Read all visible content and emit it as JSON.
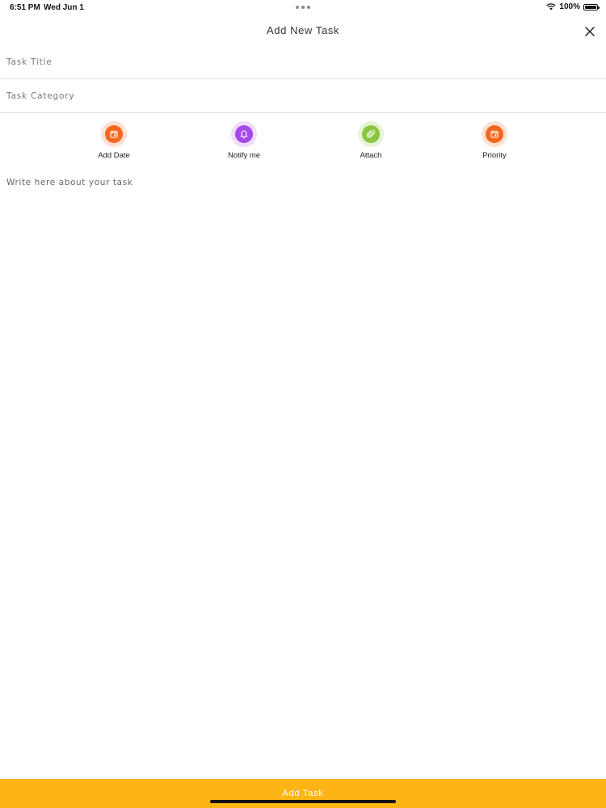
{
  "status_bar": {
    "time": "6:51 PM",
    "date": "Wed Jun 1",
    "battery": "100%",
    "icons": [
      "wifi-icon",
      "battery-icon"
    ]
  },
  "header": {
    "title": "Add New Task",
    "close_icon": "close-icon"
  },
  "form": {
    "title_placeholder": "Task Title",
    "title_value": "",
    "category_placeholder": "Task Category",
    "category_value": "",
    "description_placeholder": "Write here about your task",
    "description_value": ""
  },
  "actions": [
    {
      "label": "Add Date",
      "icon": "calendar-icon",
      "color": "#f5661f",
      "halo": "#fde0d2"
    },
    {
      "label": "Notify me",
      "icon": "bell-icon",
      "color": "#a448e6",
      "halo": "#efdcfb"
    },
    {
      "label": "Attach",
      "icon": "paperclip-icon",
      "color": "#8bc53f",
      "halo": "#e6f3d6"
    },
    {
      "label": "Priority",
      "icon": "calendar-icon",
      "color": "#f5661f",
      "halo": "#fde0d2"
    }
  ],
  "footer": {
    "button_label": "Add Task",
    "button_color": "#fdb515"
  }
}
